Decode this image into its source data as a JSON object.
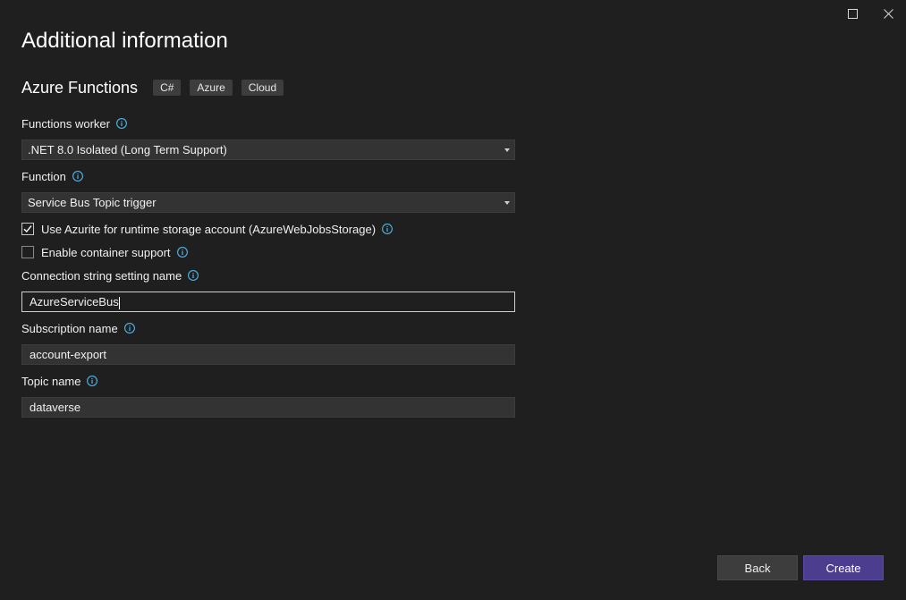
{
  "window": {
    "title": "Additional information",
    "maximize_icon": "maximize-icon",
    "close_icon": "close-icon"
  },
  "template": {
    "name": "Azure Functions",
    "tags": [
      "C#",
      "Azure",
      "Cloud"
    ]
  },
  "fields": {
    "functions_worker": {
      "label": "Functions worker",
      "value": ".NET 8.0 Isolated (Long Term Support)"
    },
    "function": {
      "label": "Function",
      "value": "Service Bus Topic trigger"
    },
    "use_azurite": {
      "label": "Use Azurite for runtime storage account (AzureWebJobsStorage)",
      "checked": true
    },
    "enable_container": {
      "label": "Enable container support",
      "checked": false
    },
    "connection_string": {
      "label": "Connection string setting name",
      "value": "AzureServiceBus"
    },
    "subscription_name": {
      "label": "Subscription name",
      "value": "account-export"
    },
    "topic_name": {
      "label": "Topic name",
      "value": "dataverse"
    }
  },
  "buttons": {
    "back": "Back",
    "create": "Create"
  },
  "colors": {
    "background": "#1f1f1f",
    "info_icon": "#4fb3e8",
    "primary_button": "#4d3d8f"
  }
}
